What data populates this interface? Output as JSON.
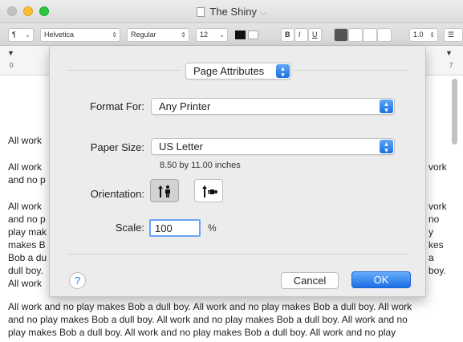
{
  "window": {
    "title": "The Shiny",
    "title_chevron": "⌵"
  },
  "toolbar": {
    "paragraph_style": "¶",
    "font_family": "Helvetica",
    "font_style": "Regular",
    "font_size": "12",
    "bold": "B",
    "italic": "I",
    "underline": "U",
    "line_spacing": "1.0",
    "text_color": "#111111",
    "highlight_color": "#ffffff"
  },
  "ruler": {
    "start_label": "0",
    "end_label": "7"
  },
  "document": {
    "left_fragments": [
      "All work",
      "All work",
      "and no p",
      "All work",
      "and no p",
      "play mak",
      "makes B",
      "Bob a du",
      "dull boy.",
      "All work"
    ],
    "right_fragments": [
      "vork",
      "vork",
      "no",
      "y",
      "kes",
      "a",
      "boy."
    ],
    "bottom_lines": [
      "All work and no play makes Bob a dull boy. All work and no play makes Bob a dull boy. All work",
      "and no play makes Bob a dull boy. All work and no play makes Bob a dull boy. All work and no",
      "play makes Bob a dull boy. All work and no play makes Bob a dull boy. All work and no play"
    ]
  },
  "sheet": {
    "settings_popup": "Page Attributes",
    "format_for_label": "Format For:",
    "format_for_value": "Any Printer",
    "paper_size_label": "Paper Size:",
    "paper_size_value": "US Letter",
    "paper_dimensions": "8.50 by 11.00 inches",
    "orientation_label": "Orientation:",
    "orientation_selected": "portrait",
    "scale_label": "Scale:",
    "scale_value": "100",
    "scale_unit": "%",
    "help_label": "?",
    "cancel_label": "Cancel",
    "ok_label": "OK"
  },
  "colors": {
    "accent": "#1c6fe4",
    "sheet_background": "#ececec"
  }
}
